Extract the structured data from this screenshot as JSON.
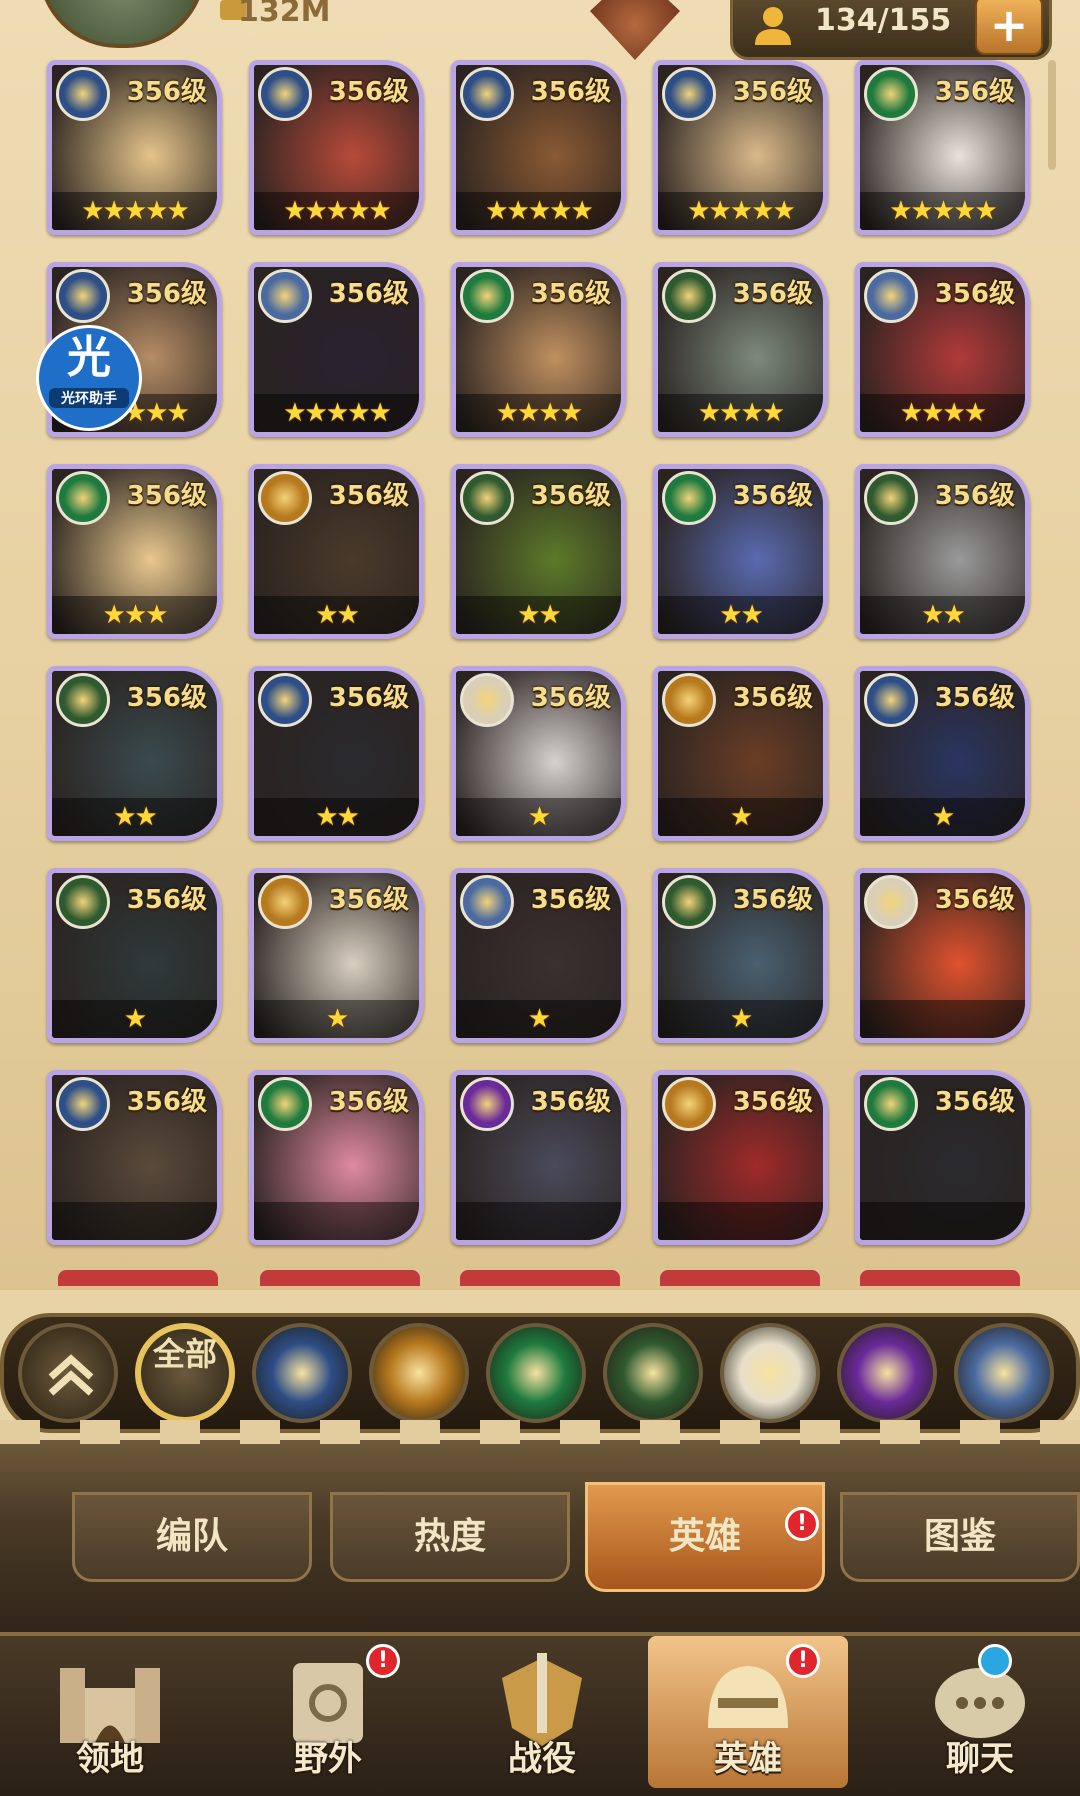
{
  "top": {
    "power_text": "132M",
    "capacity_text": "134/155",
    "add_label": "+"
  },
  "watermark": {
    "glyph": "光",
    "text": "光环助手"
  },
  "hero_grid": {
    "rows": [
      [
        {
          "level": "356级",
          "stars": "★★★★★",
          "faction": "lightbearer",
          "badge_color": "#2d4e86",
          "portrait": "#e4c48a"
        },
        {
          "level": "356级",
          "stars": "★★★★★",
          "faction": "lightbearer",
          "badge_color": "#2d4e86",
          "portrait": "#b84a3a"
        },
        {
          "level": "356级",
          "stars": "★★★★★",
          "faction": "lightbearer",
          "badge_color": "#2d4e86",
          "portrait": "#8a5a34"
        },
        {
          "level": "356级",
          "stars": "★★★★★",
          "faction": "lightbearer",
          "badge_color": "#2d4e86",
          "portrait": "#d9b98a"
        },
        {
          "level": "356级",
          "stars": "★★★★★",
          "faction": "wilder",
          "badge_color": "#1e7a3e",
          "portrait": "#e8e2da"
        }
      ],
      [
        {
          "level": "356级",
          "stars": "★★★★★",
          "faction": "lightbearer",
          "badge_color": "#2d4e86",
          "portrait": "#b58d66"
        },
        {
          "level": "356级",
          "stars": "★★★★★",
          "faction": "dimensional",
          "badge_color": "#4a6aa0",
          "portrait": "#2a2230"
        },
        {
          "level": "356级",
          "stars": "★★★★",
          "faction": "wilder",
          "badge_color": "#1e7a3e",
          "portrait": "#c09060"
        },
        {
          "level": "356级",
          "stars": "★★★★",
          "faction": "graveborn",
          "badge_color": "#2f5a2f",
          "portrait": "#7c8a7c"
        },
        {
          "level": "356级",
          "stars": "★★★★",
          "faction": "dimensional",
          "badge_color": "#4a6aa0",
          "portrait": "#b03a3a"
        }
      ],
      [
        {
          "level": "356级",
          "stars": "★★★",
          "faction": "wilder",
          "badge_color": "#1e7a3e",
          "portrait": "#e8c88e"
        },
        {
          "level": "356级",
          "stars": "★★",
          "faction": "mauler",
          "badge_color": "#b7791e",
          "portrait": "#4a3a2a"
        },
        {
          "level": "356级",
          "stars": "★★",
          "faction": "graveborn",
          "badge_color": "#2f5a2f",
          "portrait": "#5c7a2a"
        },
        {
          "level": "356级",
          "stars": "★★",
          "faction": "wilder",
          "badge_color": "#1e7a3e",
          "portrait": "#5a6ab0"
        },
        {
          "level": "356级",
          "stars": "★★",
          "faction": "graveborn",
          "badge_color": "#2f5a2f",
          "portrait": "#9a9a9a"
        }
      ],
      [
        {
          "level": "356级",
          "stars": "★★",
          "faction": "graveborn",
          "badge_color": "#2f5a2f",
          "portrait": "#3a4a4e"
        },
        {
          "level": "356级",
          "stars": "★★",
          "faction": "lightbearer",
          "badge_color": "#2d4e86",
          "portrait": "#2a2a2e"
        },
        {
          "level": "356级",
          "stars": "★",
          "faction": "celestial",
          "badge_color": "#d8cfb6",
          "portrait": "#d6d0cf"
        },
        {
          "level": "356级",
          "stars": "★",
          "faction": "mauler",
          "badge_color": "#b7791e",
          "portrait": "#6a3e26"
        },
        {
          "level": "356级",
          "stars": "★",
          "faction": "lightbearer",
          "badge_color": "#2d4e86",
          "portrait": "#2a3560"
        }
      ],
      [
        {
          "level": "356级",
          "stars": "★",
          "faction": "graveborn",
          "badge_color": "#2f5a2f",
          "portrait": "#2e3a3a"
        },
        {
          "level": "356级",
          "stars": "★",
          "faction": "mauler",
          "badge_color": "#b7791e",
          "portrait": "#d8cfc0"
        },
        {
          "level": "356级",
          "stars": "★",
          "faction": "dimensional",
          "badge_color": "#4a6aa0",
          "portrait": "#3a3030"
        },
        {
          "level": "356级",
          "stars": "★",
          "faction": "graveborn",
          "badge_color": "#2f5a2f",
          "portrait": "#4a6070"
        },
        {
          "level": "356级",
          "stars": "",
          "faction": "celestial",
          "badge_color": "#d8cfb6",
          "portrait": "#e0522e"
        }
      ],
      [
        {
          "level": "356级",
          "stars": "",
          "faction": "lightbearer",
          "badge_color": "#2d4e86",
          "portrait": "#5a4a3a"
        },
        {
          "level": "356级",
          "stars": "",
          "faction": "wilder",
          "badge_color": "#1e7a3e",
          "portrait": "#e08aa0"
        },
        {
          "level": "356级",
          "stars": "",
          "faction": "hypogean",
          "badge_color": "#6a2a9a",
          "portrait": "#4a4a5a"
        },
        {
          "level": "356级",
          "stars": "",
          "faction": "mauler",
          "badge_color": "#b7791e",
          "portrait": "#a02a2a"
        },
        {
          "level": "356级",
          "stars": "",
          "faction": "wilder",
          "badge_color": "#1e7a3e",
          "portrait": "#2a2a2e"
        }
      ]
    ]
  },
  "filters": {
    "collapse_icon": "double-chevron-up-icon",
    "all_label": "全部",
    "factions": [
      {
        "name": "lightbearer",
        "color": "#2d4e86",
        "icon": "star-compass-icon"
      },
      {
        "name": "mauler",
        "color": "#b7791e",
        "icon": "mauler-emblem-icon"
      },
      {
        "name": "wilder",
        "color": "#1e7a3e",
        "icon": "leaf-icon"
      },
      {
        "name": "graveborn",
        "color": "#2f5a2f",
        "icon": "eye-icon"
      },
      {
        "name": "celestial",
        "color": "#e6dfca",
        "icon": "starburst-icon"
      },
      {
        "name": "hypogean",
        "color": "#6a2a9a",
        "icon": "void-crystal-icon"
      },
      {
        "name": "dimensional",
        "color": "#4a6aa0",
        "icon": "portal-ring-icon"
      }
    ]
  },
  "tabs": [
    {
      "label": "编队",
      "active": false,
      "alert": false
    },
    {
      "label": "热度",
      "active": false,
      "alert": false
    },
    {
      "label": "英雄",
      "active": true,
      "alert": true
    },
    {
      "label": "图鉴",
      "active": false,
      "alert": false
    }
  ],
  "alert_mark": "!",
  "bottom_nav": [
    {
      "label": "领地",
      "icon": "castle-icon",
      "active": false,
      "alert": false
    },
    {
      "label": "野外",
      "icon": "scroll-map-icon",
      "active": false,
      "alert": true
    },
    {
      "label": "战役",
      "icon": "sword-shield-icon",
      "active": false,
      "alert": false
    },
    {
      "label": "英雄",
      "icon": "helmet-icon",
      "active": true,
      "alert": true
    },
    {
      "label": "聊天",
      "icon": "chat-bubble-icon",
      "active": false,
      "alert": false
    }
  ],
  "colors": {
    "accent_gold": "#e8c35d",
    "alert_red": "#e0262c",
    "active_tab": "#e19a4c",
    "card_border": "#b9a5e6"
  }
}
